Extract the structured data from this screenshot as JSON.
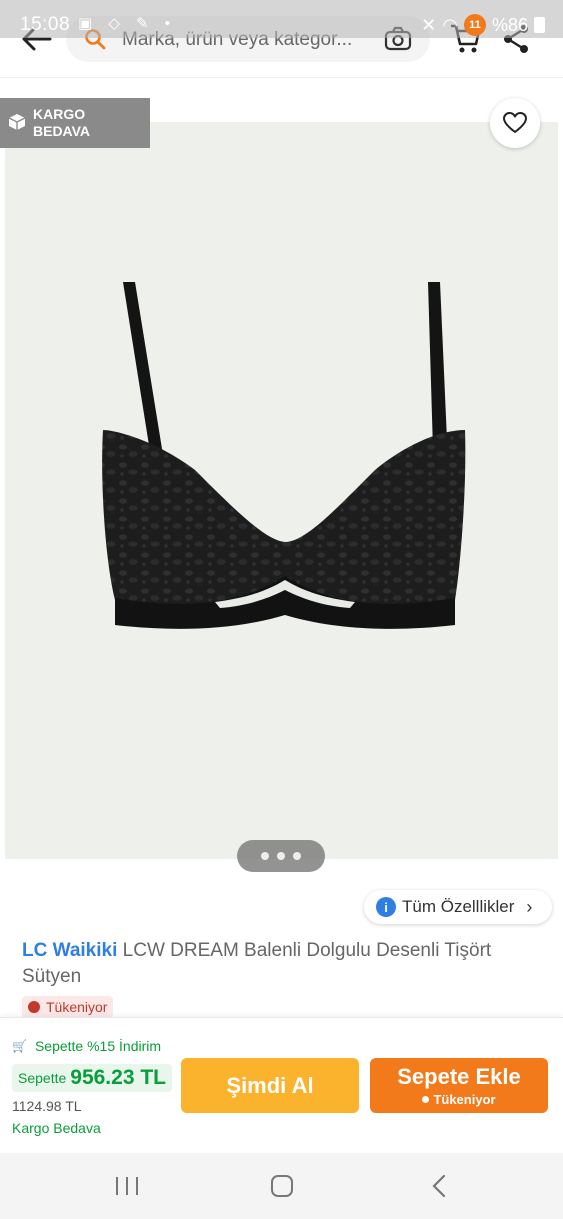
{
  "status_bar": {
    "time": "15:08",
    "notification_count": "11",
    "battery": "%86"
  },
  "header": {
    "search_placeholder": "Marka, ürün veya kategor...",
    "cart_count": ""
  },
  "product": {
    "cargo_tag": "KARGO\nBEDAVA",
    "cargo_tag_line1": "KARGO",
    "cargo_tag_line2": "BEDAVA",
    "brand": "LC Waikiki",
    "name": "LCW DREAM Balenli Dolgulu Desenli Tişört Sütyen",
    "stock_status": "Tükeniyor",
    "all_features_label": "Tüm Özelllikler",
    "image_dots": 3
  },
  "purchase": {
    "discount_text": "Sepette %15 İndirim",
    "cart_price_label": "Sepette",
    "cart_price": "956.23 TL",
    "old_price": "1124.98 TL",
    "free_cargo": "Kargo Bedava",
    "buy_now_label": "Şimdi Al",
    "add_to_cart_label": "Sepete Ekle",
    "add_to_cart_sub": "Tükeniyor"
  },
  "colors": {
    "accent_orange": "#f27a1a",
    "buy_now_yellow": "#fbb22d",
    "brand_blue": "#2f7ee3",
    "discount_green": "#0a9e3b"
  }
}
